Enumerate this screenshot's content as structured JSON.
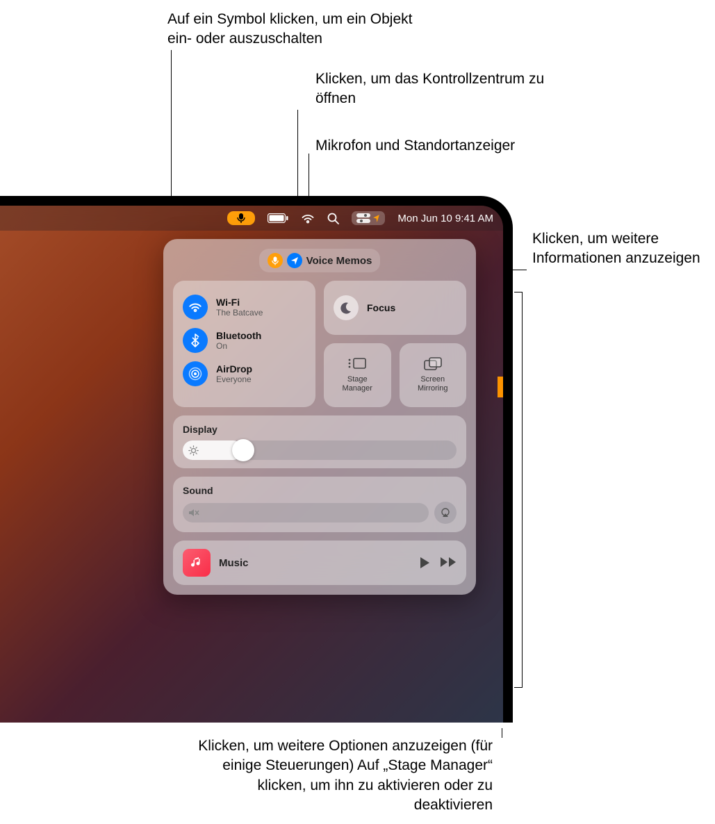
{
  "callouts": {
    "toggle": "Auf ein Symbol klicken, um ein Objekt ein- oder auszuschalten",
    "open_cc": "Klicken, um das Kontrollzentrum zu öffnen",
    "mic_loc": "Mikrofon und Standortanzeiger",
    "more_info": "Klicken, um weitere Informationen anzuzeigen",
    "more_options": "Klicken, um weitere Optionen anzuzeigen (für einige Steuerungen) Auf „Stage Manager“ klicken, um ihn zu aktivieren oder zu deaktivieren"
  },
  "menubar": {
    "date_time": "Mon Jun 10  9:41 AM"
  },
  "status": {
    "app": "Voice Memos"
  },
  "connectivity": {
    "wifi": {
      "title": "Wi-Fi",
      "sub": "The Batcave"
    },
    "bluetooth": {
      "title": "Bluetooth",
      "sub": "On"
    },
    "airdrop": {
      "title": "AirDrop",
      "sub": "Everyone"
    }
  },
  "focus": {
    "title": "Focus"
  },
  "stage": {
    "label": "Stage Manager"
  },
  "mirror": {
    "label": "Screen Mirroring"
  },
  "display": {
    "label": "Display",
    "value_pct": 22
  },
  "sound": {
    "label": "Sound",
    "value_pct": 0
  },
  "music": {
    "label": "Music"
  }
}
